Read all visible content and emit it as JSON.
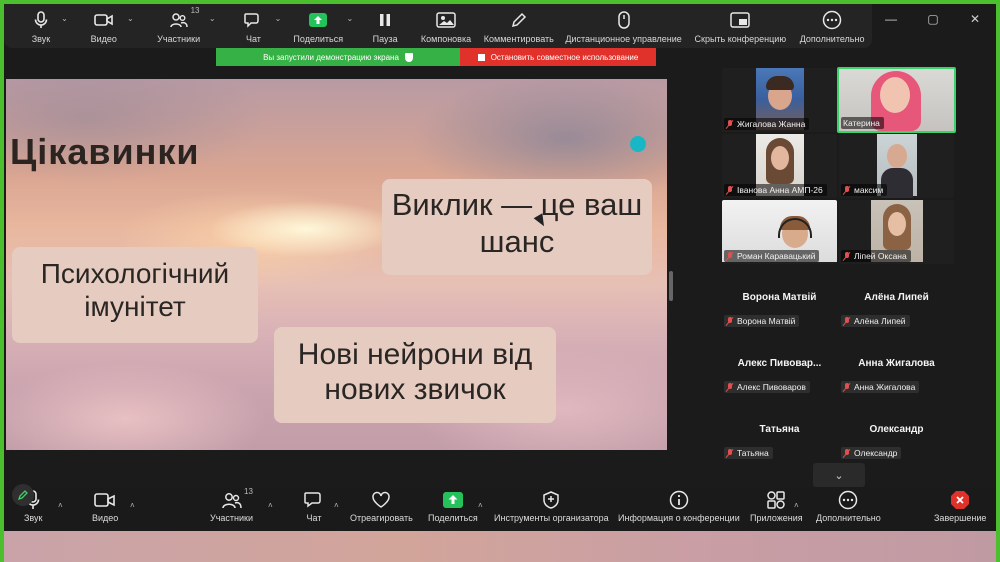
{
  "window_controls": [
    "—",
    "▢",
    "✕"
  ],
  "share_toolbar": {
    "items": [
      {
        "label": "Звук",
        "icon": "mic-icon"
      },
      {
        "label": "Видео",
        "icon": "video-icon"
      },
      {
        "label": "Участники",
        "icon": "participants-icon",
        "count": "13"
      },
      {
        "label": "Чат",
        "icon": "chat-icon"
      },
      {
        "label": "Поделиться",
        "icon": "share-screen-icon"
      },
      {
        "label": "Пауза",
        "icon": "pause-icon"
      },
      {
        "label": "Компоновка",
        "icon": "layout-icon"
      },
      {
        "label": "Комментировать",
        "icon": "annotate-icon"
      },
      {
        "label": "Дистанционное управление",
        "icon": "remote-control-icon"
      },
      {
        "label": "Скрыть конференцию",
        "icon": "hide-meeting-icon"
      },
      {
        "label": "Дополнительно",
        "icon": "more-icon"
      }
    ]
  },
  "share_banner": {
    "status": "Вы запустили демонстрацию экрана",
    "stop": "Остановить совместное использование"
  },
  "slide": {
    "title": "Цікавинки",
    "bubble1": "Виклик — це ваш шанс",
    "bubble2": "Психологічний імунітет",
    "bubble3": "Нові нейрони від нових звичок",
    "accent": "#19b7c6"
  },
  "gallery": {
    "video_tiles": [
      {
        "name": "Жигалова Жанна",
        "muted": true
      },
      {
        "name": "Катерина",
        "muted": false,
        "active": true
      },
      {
        "name": "Іванова Анна АМП-26",
        "muted": true
      },
      {
        "name": "максим",
        "muted": true
      },
      {
        "name": "Роман Каравацький",
        "muted": true
      },
      {
        "name": "Ліпей Оксана",
        "muted": true
      }
    ],
    "name_tiles": [
      {
        "display": "Ворона Матвій",
        "label": "Ворона Матвій"
      },
      {
        "display": "Алёна Липей",
        "label": "Алёна Липей"
      },
      {
        "display": "Алекс  Пивовар...",
        "label": "Алекс Пивоваров"
      },
      {
        "display": "Анна Жигалова",
        "label": "Анна Жигалова"
      },
      {
        "display": "Татьяна",
        "label": "Татьяна"
      },
      {
        "display": "Олександр",
        "label": "Олександр"
      }
    ]
  },
  "bottom_toolbar": {
    "items": [
      {
        "label": "Звук",
        "icon": "mic-icon"
      },
      {
        "label": "Видео",
        "icon": "video-icon"
      },
      {
        "label": "Участники",
        "icon": "participants-icon",
        "count": "13"
      },
      {
        "label": "Чат",
        "icon": "chat-icon"
      },
      {
        "label": "Отреагировать",
        "icon": "react-icon"
      },
      {
        "label": "Поделиться",
        "icon": "share-screen-icon"
      },
      {
        "label": "Инструменты организатора",
        "icon": "host-tools-icon"
      },
      {
        "label": "Информация о конференции",
        "icon": "info-icon"
      },
      {
        "label": "Приложения",
        "icon": "apps-icon"
      },
      {
        "label": "Дополнительно",
        "icon": "more-icon"
      },
      {
        "label": "Завершение",
        "icon": "end-icon"
      }
    ]
  },
  "colors": {
    "share_border": "#4cbf2e",
    "banner_green": "#36b146",
    "banner_red": "#e0322b",
    "active_speaker": "#3ad36a",
    "muted_mic": "#e05050"
  }
}
